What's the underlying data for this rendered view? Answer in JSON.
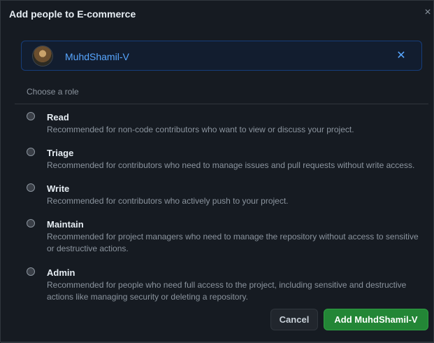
{
  "dialog": {
    "title": "Add people to E-commerce",
    "close_icon": "×"
  },
  "selected_user": {
    "name": "MuhdShamil-V",
    "remove_icon": "✕"
  },
  "roles_heading": "Choose a role",
  "roles": [
    {
      "name": "Read",
      "description": "Recommended for non-code contributors who want to view or discuss your project."
    },
    {
      "name": "Triage",
      "description": "Recommended for contributors who need to manage issues and pull requests without write access."
    },
    {
      "name": "Write",
      "description": "Recommended for contributors who actively push to your project."
    },
    {
      "name": "Maintain",
      "description": "Recommended for project managers who need to manage the repository without access to sensitive or destructive actions."
    },
    {
      "name": "Admin",
      "description": "Recommended for people who need full access to the project, including sensitive and destructive actions like managing security or deleting a repository."
    }
  ],
  "buttons": {
    "cancel": "Cancel",
    "add": "Add MuhdShamil-V"
  },
  "colors": {
    "background": "#161b22",
    "link_blue": "#58a6ff",
    "primary_green": "#238636"
  }
}
